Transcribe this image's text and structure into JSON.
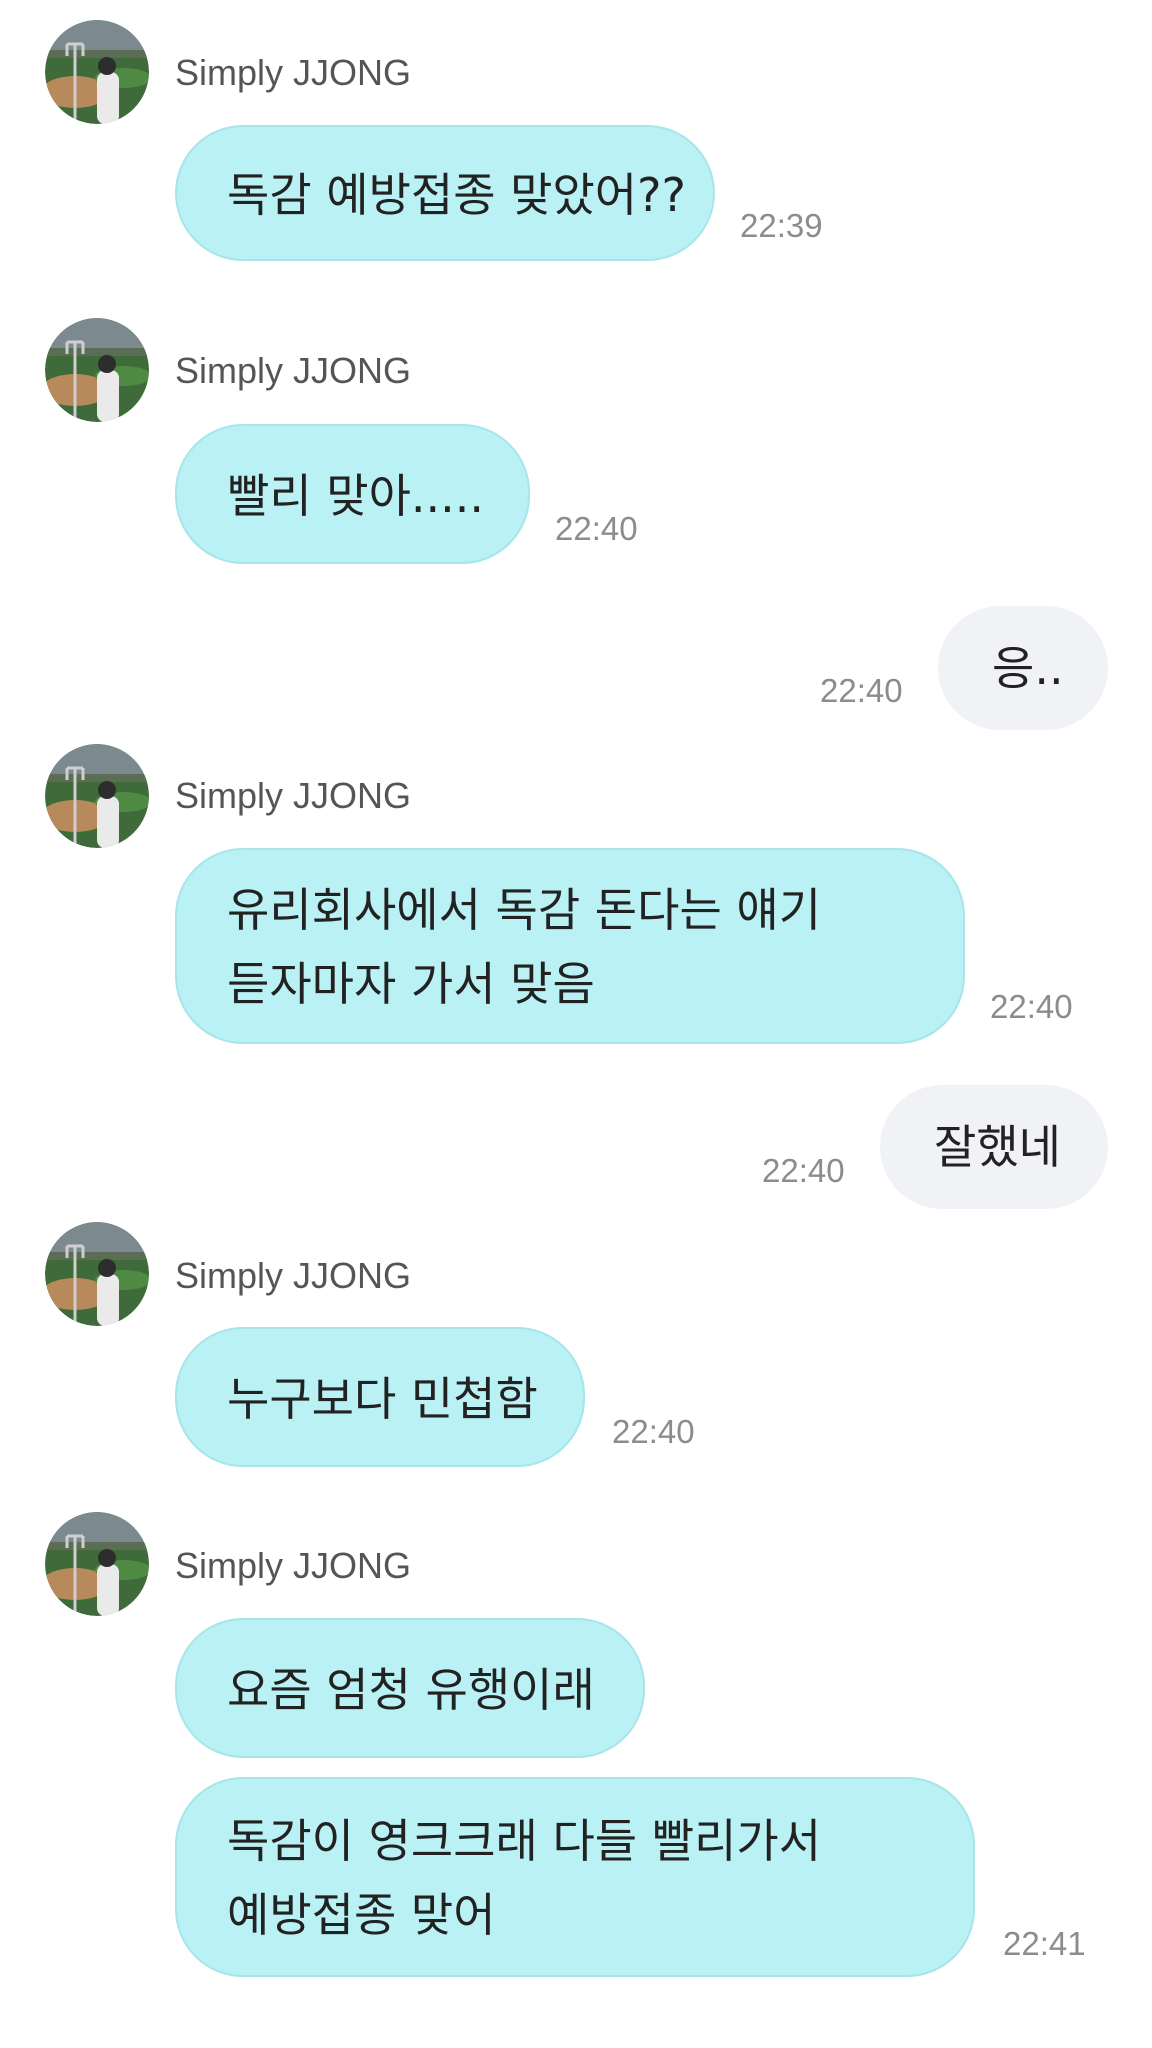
{
  "chat": {
    "sender_name": "Simply JJONG",
    "colors": {
      "incoming_bubble": "#b9f1f4",
      "outgoing_bubble": "#f1f2f6",
      "timestamp": "#8c8c8c",
      "sender_name": "#555555"
    },
    "messages": [
      {
        "direction": "in",
        "lines": [
          "독감 예방접종 맞았어??"
        ],
        "time": "22:39"
      },
      {
        "direction": "in",
        "lines": [
          "빨리 맞아....."
        ],
        "time": "22:40"
      },
      {
        "direction": "out",
        "lines": [
          "응.."
        ],
        "time": "22:40"
      },
      {
        "direction": "in",
        "lines": [
          "유리회사에서 독감 돈다는 얘기",
          "듣자마자 가서 맞음"
        ],
        "time": "22:40"
      },
      {
        "direction": "out",
        "lines": [
          "잘했네"
        ],
        "time": "22:40"
      },
      {
        "direction": "in",
        "lines": [
          "누구보다 민첩함"
        ],
        "time": "22:40"
      },
      {
        "direction": "in",
        "lines": [
          "요즘 엄청 유행이래"
        ],
        "time": ""
      },
      {
        "direction": "in",
        "lines": [
          "독감이 영크크래 다들 빨리가서",
          "예방접종 맞어"
        ],
        "time": "22:41"
      }
    ]
  }
}
